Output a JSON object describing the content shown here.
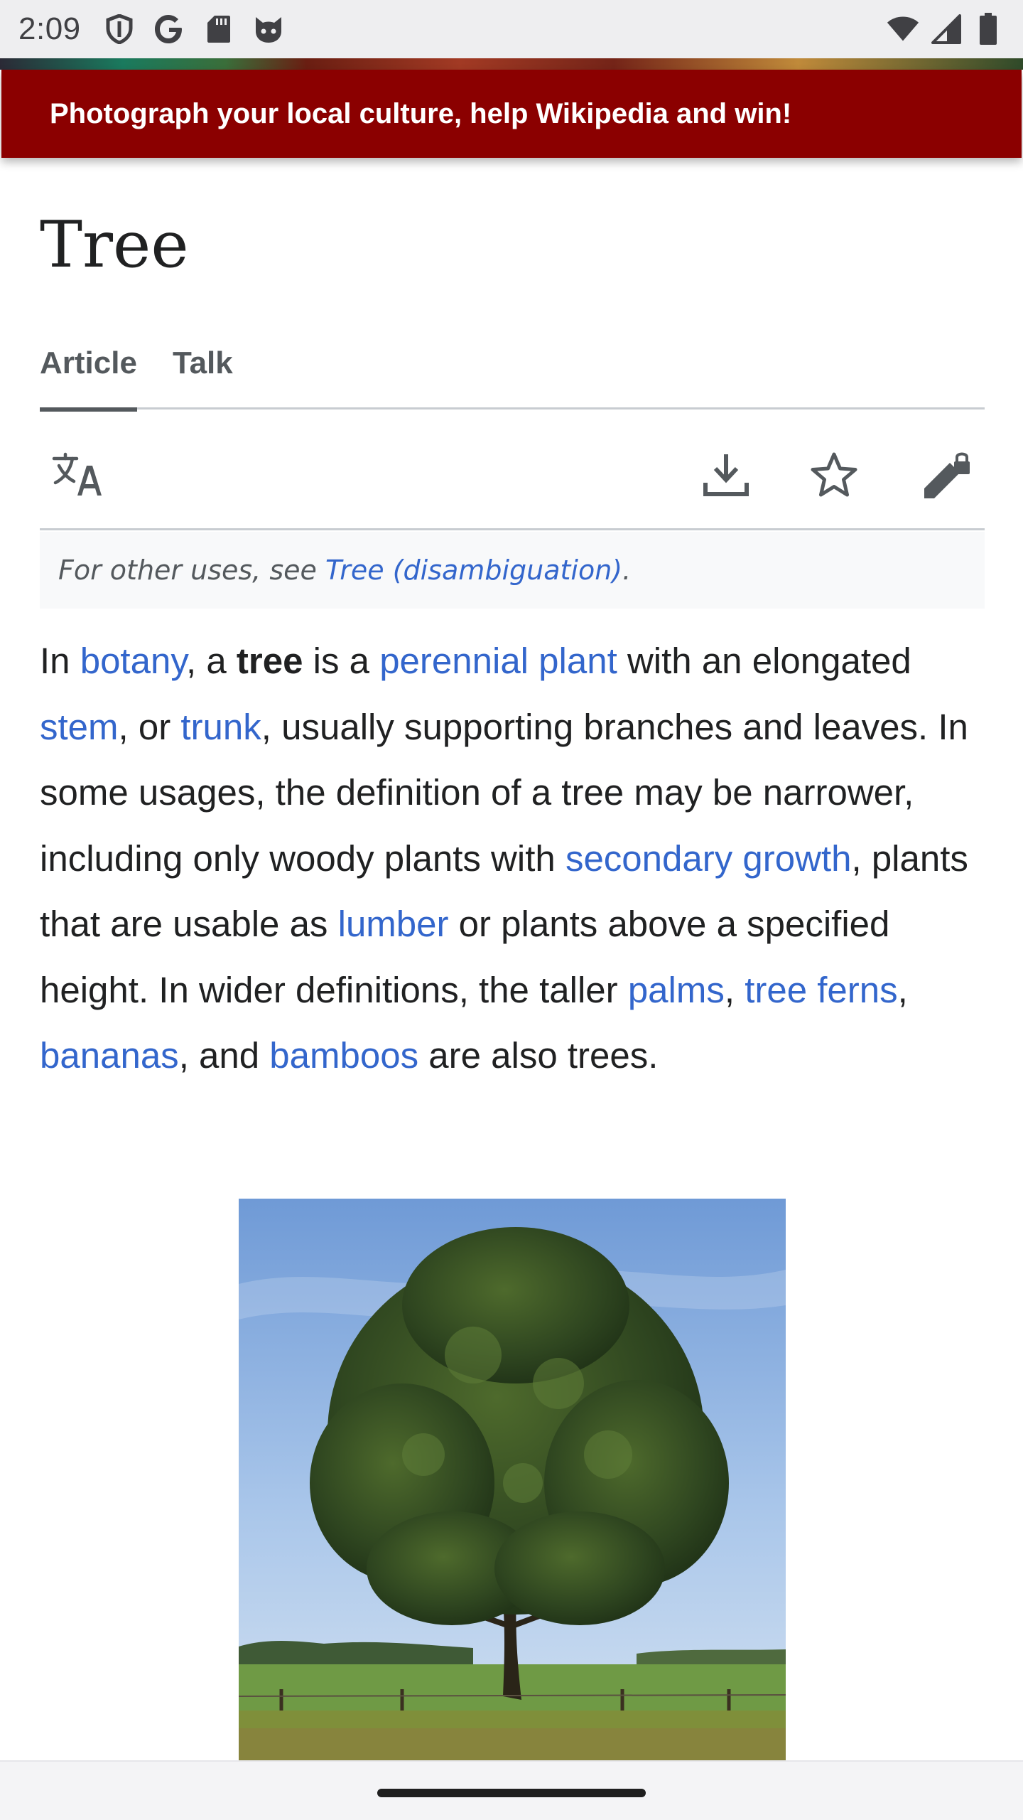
{
  "status_bar": {
    "time": "2:09",
    "left_icons": [
      "shield-icon",
      "google-icon",
      "sd-card-icon",
      "cat-face-icon"
    ],
    "right_icons": [
      "wifi-icon",
      "cell-signal-icon",
      "battery-icon"
    ]
  },
  "campaign_banner": {
    "text": "Photograph your local culture, help Wikipedia and win!",
    "color": "#8b0000"
  },
  "article": {
    "title": "Tree",
    "tabs": [
      {
        "label": "Article",
        "active": true
      },
      {
        "label": "Talk",
        "active": false
      }
    ],
    "actions": [
      "translate-icon",
      "download-icon",
      "star-icon",
      "edit-locked-icon"
    ],
    "hatnote": {
      "prefix": "For other uses, see ",
      "link": "Tree (disambiguation)",
      "suffix": "."
    },
    "lead": {
      "t1": "In ",
      "l_botany": "botany",
      "t2": ", a ",
      "bold": "tree",
      "t3": " is a ",
      "l_perennial": "perennial plant",
      "t4": " with an elongated ",
      "l_stem": "stem",
      "t5": ", or ",
      "l_trunk": "trunk",
      "t6": ", usually supporting branches and leaves. In some usages, the definition of a tree may be narrower, including only woody plants with ",
      "l_secondary": "secondary growth",
      "t7": ", plants that are usable as ",
      "l_lumber": "lumber",
      "t8": " or plants above a specified height. In wider definitions, the taller ",
      "l_palms": "palms",
      "t9": ", ",
      "l_treeferns": "tree ferns",
      "t10": ", ",
      "l_bananas": "bananas",
      "t11": ", and ",
      "l_bamboos": "bamboos",
      "t12": " are also trees."
    }
  },
  "colors": {
    "link": "#3366cc",
    "text": "#202122",
    "muted": "#54595d"
  }
}
